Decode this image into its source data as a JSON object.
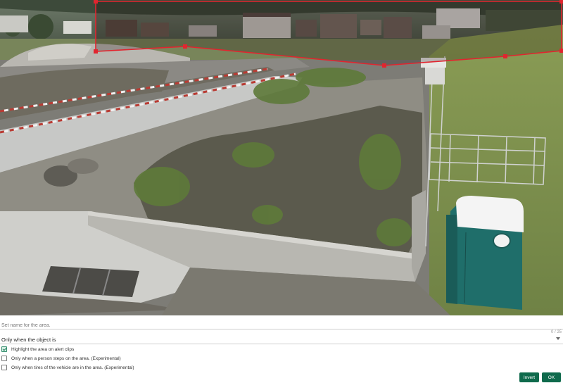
{
  "zone_editor": {
    "name_placeholder": "Set name for the area.",
    "name_value": "",
    "char_count": "0 / 25",
    "trigger_select": {
      "selected": "Only when the object is"
    },
    "options": [
      {
        "label": "Highlight the area on alert clips",
        "checked": true
      },
      {
        "label": "Only when a person steps on the area. (Experimental)",
        "checked": false
      },
      {
        "label": "Only when tires of the vehicle are in the area. (Experimental)",
        "checked": false
      }
    ],
    "buttons": {
      "invert": "Invert",
      "ok": "OK"
    }
  },
  "colors": {
    "zone_outline": "#e1252f",
    "button_bg": "#0f6a4c",
    "checkbox_checked": "#2e8b6a",
    "toilet_body": "#1f6e6a",
    "toilet_roof": "#f4f4f4"
  },
  "icons": {
    "zone_handle": "square-handle-icon",
    "select_caret": "chevron-down-icon",
    "checkbox_check": "check-icon"
  }
}
